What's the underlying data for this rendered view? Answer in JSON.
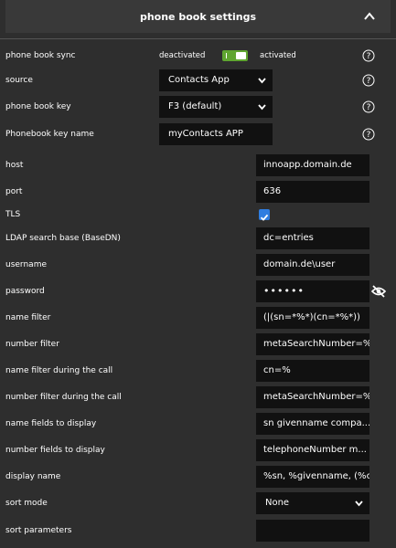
{
  "header": {
    "title": "phone book settings"
  },
  "fields": {
    "sync": {
      "label": "phone book sync",
      "off": "deactivated",
      "on": "activated"
    },
    "source": {
      "label": "source",
      "value": "Contacts App"
    },
    "key": {
      "label": "phone book key",
      "value": "F3 (default)"
    },
    "key_name": {
      "label": "Phonebook key name",
      "value": "myContacts APP"
    },
    "host": {
      "label": "host",
      "value": "innoapp.domain.de"
    },
    "port": {
      "label": "port",
      "value": "636"
    },
    "tls": {
      "label": "TLS",
      "checked": true
    },
    "ldap_base": {
      "label": "LDAP search base (BaseDN)",
      "value": "dc=entries"
    },
    "username": {
      "label": "username",
      "value": "domain.de\\user"
    },
    "password": {
      "label": "password",
      "value": "••••••"
    },
    "name_filter": {
      "label": "name filter",
      "value": "(|(sn=*%*)(cn=*%*))"
    },
    "number_filter": {
      "label": "number filter",
      "value": "metaSearchNumber=%"
    },
    "name_filter_call": {
      "label": "name filter during the call",
      "value": "cn=%"
    },
    "number_filter_call": {
      "label": "number filter during the call",
      "value": "metaSearchNumber=%"
    },
    "name_fields": {
      "label": "name fields to display",
      "value": "sn givenname compa..."
    },
    "number_fields": {
      "label": "number fields to display",
      "value": "telephoneNumber m..."
    },
    "display_name": {
      "label": "display name",
      "value": "%sn, %givenname, (%c..."
    },
    "sort_mode": {
      "label": "sort mode",
      "value": "None"
    },
    "sort_params": {
      "label": "sort parameters",
      "value": ""
    }
  },
  "colors": {
    "toggle_on": "#5fa530",
    "checkbox": "#2f7de0",
    "input_bg": "#111111",
    "panel_bg": "#2e2e2e"
  },
  "icons": [
    "chevron-up-icon",
    "help-icon",
    "dropdown-arrow-icon",
    "eye-slash-icon"
  ]
}
